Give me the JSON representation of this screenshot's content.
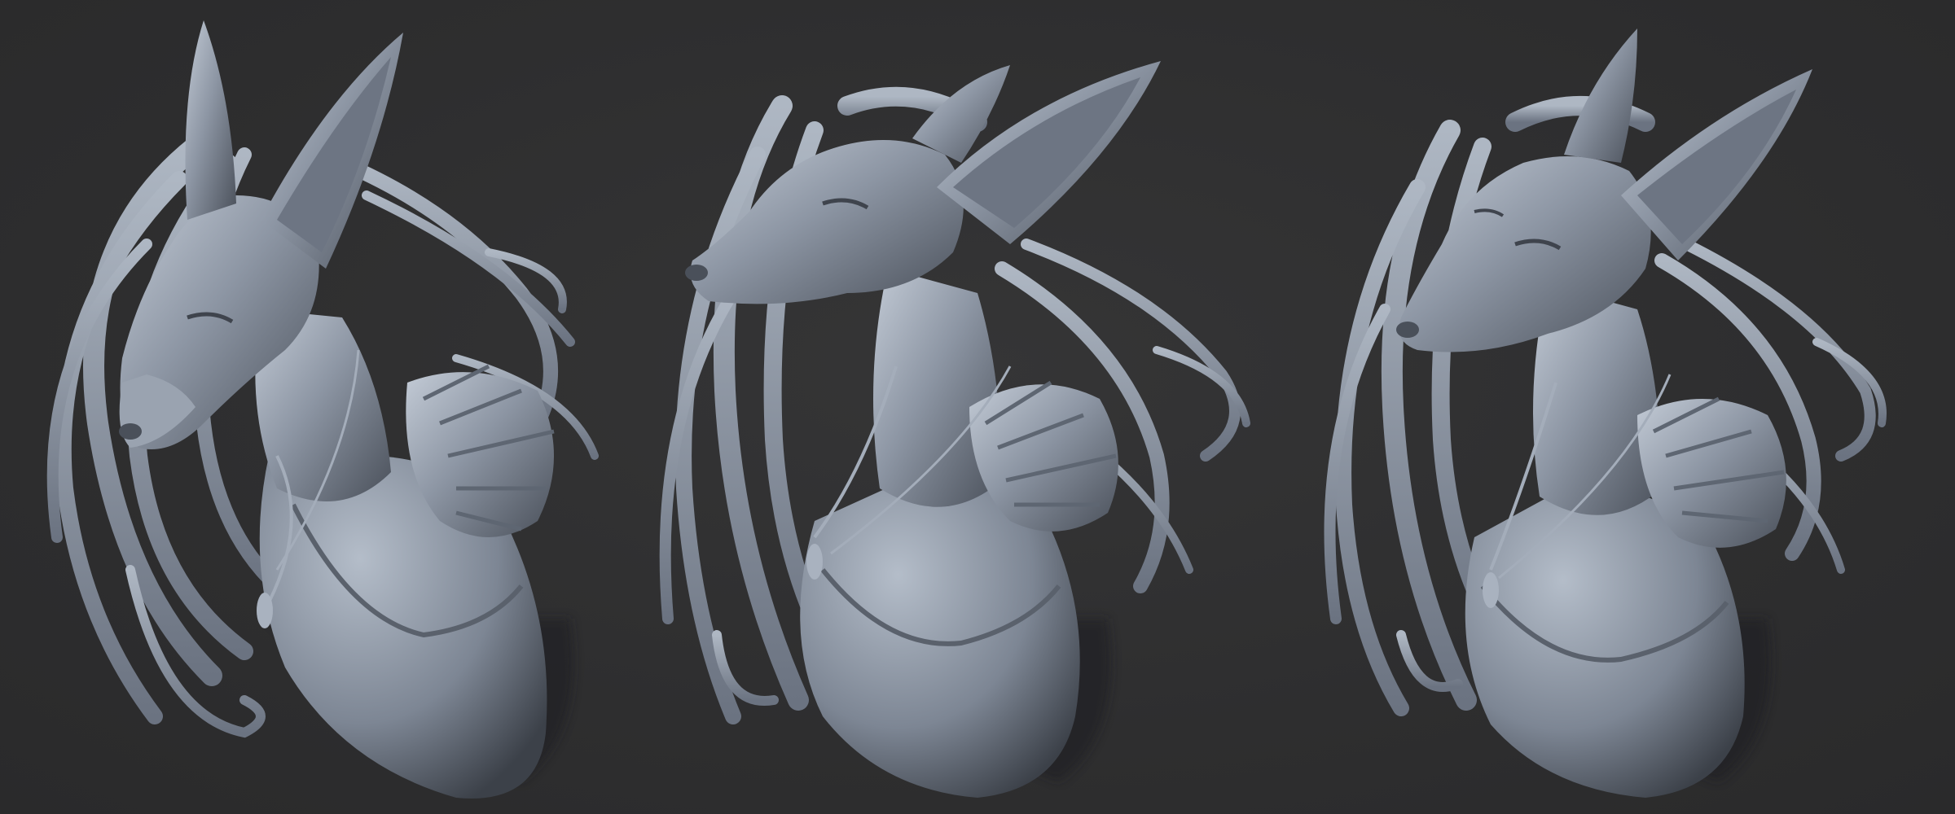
{
  "scene": {
    "subject": "sculpted-fox-bust",
    "view_count": 3,
    "views": [
      {
        "name": "view-three-quarter-left"
      },
      {
        "name": "view-profile-left"
      },
      {
        "name": "view-three-quarter-front"
      }
    ]
  },
  "colors": {
    "background": "#2f2f30",
    "clay_light": "#b9c2ce",
    "clay_mid": "#7f8896",
    "clay_dark": "#454b55",
    "shadow": "#1f1f21"
  }
}
